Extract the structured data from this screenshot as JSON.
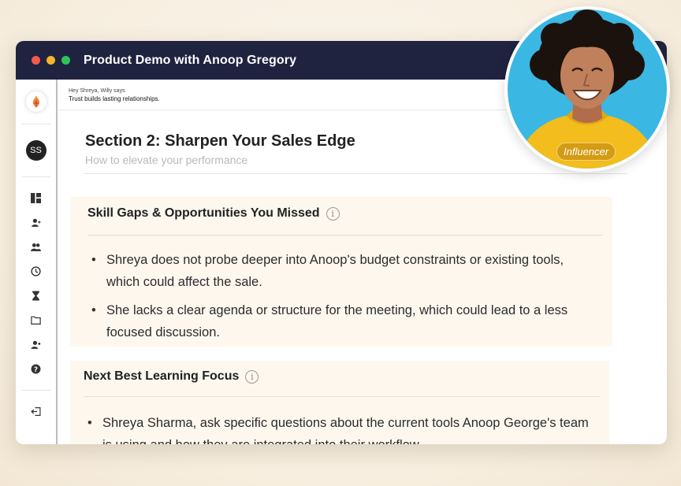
{
  "window": {
    "title": "Product Demo with Anoop Gregory"
  },
  "sidebar": {
    "avatar_initials": "SS",
    "icons": [
      "dashboard-icon",
      "add-person-icon",
      "group-icon",
      "clock-icon",
      "hourglass-icon",
      "folder-icon",
      "person-settings-icon",
      "help-icon",
      "logout-icon"
    ]
  },
  "greeting": {
    "small": "Hey Shreya, Willy says",
    "message": "Trust builds lasting relationships."
  },
  "section": {
    "title": "Section 2: Sharpen Your Sales Edge",
    "subtitle": "How to elevate your performance"
  },
  "cards": [
    {
      "title": "Skill Gaps & Opportunities You Missed",
      "bullets": [
        "Shreya does not probe deeper into Anoop's budget constraints or existing tools, which could affect the sale.",
        "She lacks a clear agenda or structure for the meeting, which could lead to a less focused discussion."
      ]
    },
    {
      "title": "Next Best Learning Focus",
      "bullets": [
        "Shreya Sharma, ask specific questions about the current tools Anoop George's team is using and how they are integrated into their workflow."
      ]
    }
  ],
  "info_symbol": "i",
  "influencer": {
    "label": "Influencer"
  },
  "colors": {
    "titlebar": "#1f2340",
    "card_bg": "#fdf7ee",
    "badge": "#d49b14",
    "portrait_bg": "#3ab7e3",
    "sweater": "#f2bd1d"
  }
}
